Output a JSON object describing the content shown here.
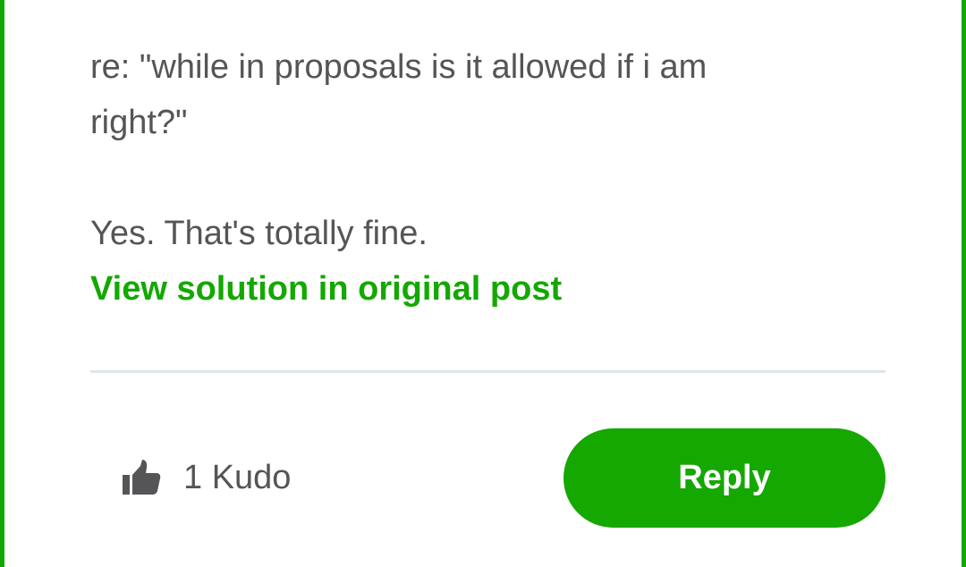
{
  "post": {
    "quote_line_1": "re: \"while in proposals is it allowed if i am",
    "quote_line_2": "right?\"",
    "answer": "Yes. That's totally fine.",
    "solution_link": "View solution in original post"
  },
  "footer": {
    "kudo_label": "1 Kudo",
    "reply_label": "Reply"
  },
  "theme": {
    "accent": "#14a800",
    "text": "#555558",
    "divider": "#dfe6e6",
    "background": "#ffffff"
  },
  "icons": {
    "kudo": "thumbs-up-icon"
  }
}
